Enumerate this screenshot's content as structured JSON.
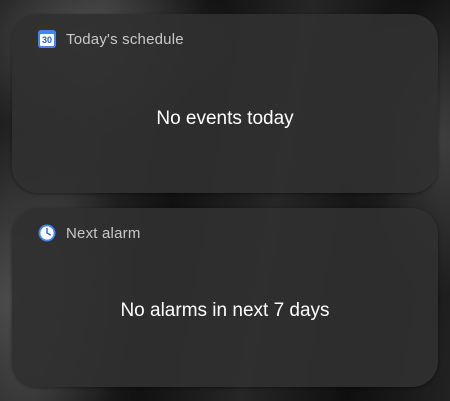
{
  "widgets": [
    {
      "title": "Today's schedule",
      "icon": "calendar-icon",
      "icon_text": "30",
      "message": "No events today"
    },
    {
      "title": "Next alarm",
      "icon": "clock-icon",
      "message": "No alarms in next 7 days"
    }
  ],
  "colors": {
    "card_background": "#303030",
    "title_text": "#c9c9c9",
    "message_text": "#ffffff",
    "icon_accent": "#4285f4"
  }
}
